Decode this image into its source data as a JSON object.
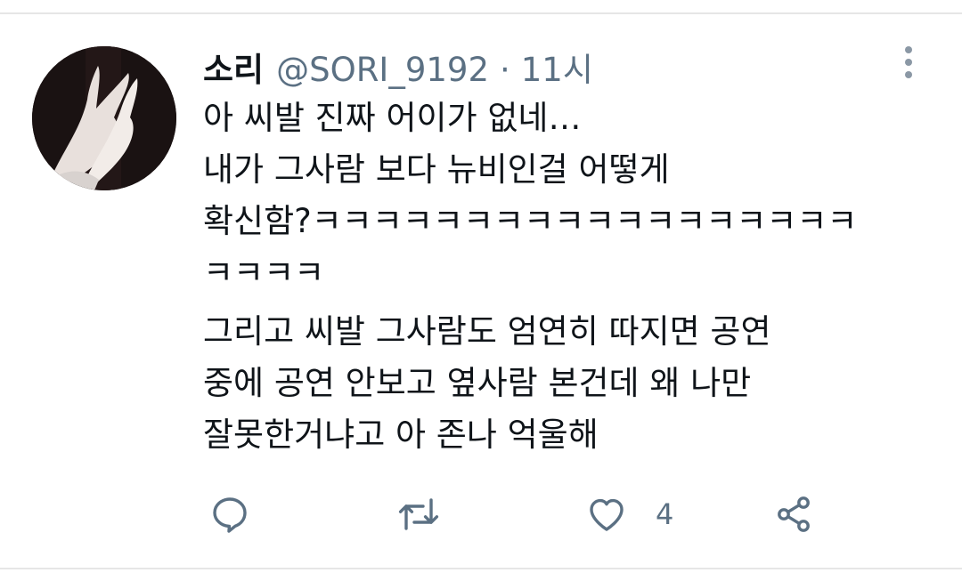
{
  "tweet": {
    "author": {
      "display_name": "소리",
      "handle": "@SORI_9192"
    },
    "separator": "·",
    "time": "11시",
    "lines": [
      "아 씨발 진짜 어이가 없네…",
      "내가 그사람 보다 뉴비인걸 어떻게",
      "확신함?ㅋㅋㅋㅋㅋㅋㅋㅋㅋㅋㅋㅋㅋㅋㅋㅋㅋㅋ",
      "ㅋㅋㅋㅋ",
      "그리고 씨발 그사람도 엄연히 따지면 공연",
      "중에 공연 안보고 옆사람 본건데 왜 나만",
      "잘못한거냐고 아 존나 억울해"
    ],
    "actions": {
      "reply_icon": "reply-icon",
      "retweet_icon": "retweet-icon",
      "like_icon": "heart-icon",
      "like_count": "4",
      "share_icon": "share-icon"
    }
  },
  "colors": {
    "text": "#0f1419",
    "secondary": "#5b7083",
    "divider": "#e6e6e6"
  }
}
